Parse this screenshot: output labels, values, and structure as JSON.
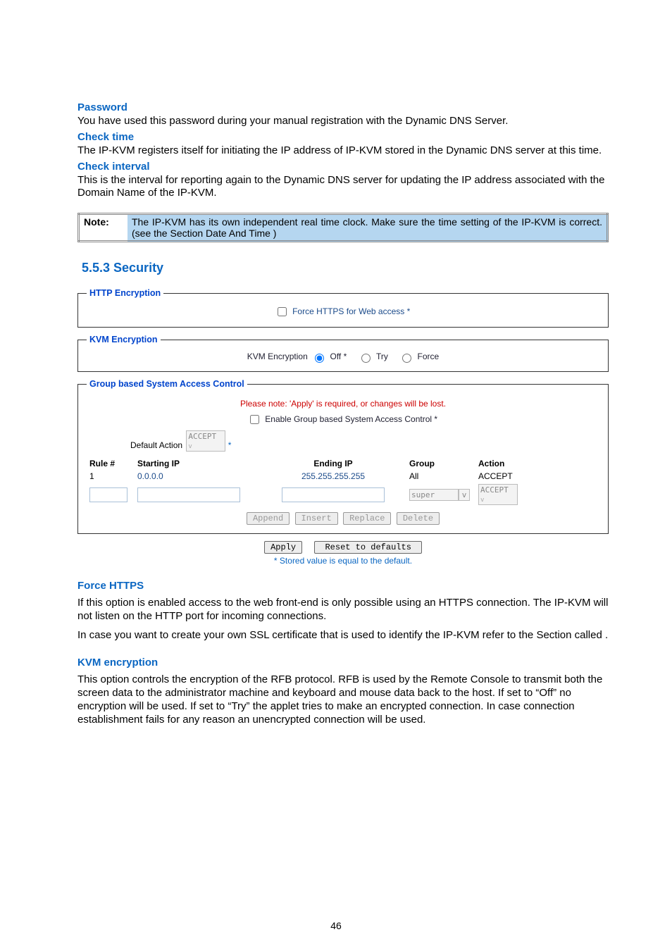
{
  "sections": {
    "password": {
      "heading": "Password",
      "body": "You have used this password during your manual registration with the Dynamic DNS Server."
    },
    "checkTime": {
      "heading": "Check time",
      "body": "The IP-KVM registers itself for initiating the IP address of IP-KVM stored in the Dynamic DNS server at this time."
    },
    "checkInterval": {
      "heading": "Check interval",
      "body": "This is the interval for reporting again to the Dynamic DNS server for updating the IP address associated with the Domain Name of the IP-KVM."
    }
  },
  "note": {
    "label": "Note:",
    "body": "The IP-KVM has its own independent real time clock. Make sure the time setting of the IP-KVM is correct. (see the Section Date And Time )"
  },
  "securityHeading": "5.5.3 Security",
  "httpEncryption": {
    "legend": "HTTP Encryption",
    "checkboxLabel": "Force HTTPS for Web access *"
  },
  "kvmEncryption": {
    "legend": "KVM Encryption",
    "label": "KVM Encryption",
    "options": {
      "off": "Off *",
      "try": "Try",
      "force": "Force"
    }
  },
  "groupControl": {
    "legend": "Group based System Access Control",
    "warning": "Please note: 'Apply' is required, or changes will be lost.",
    "enableLabel": "Enable Group based System Access Control *",
    "defaultActionLabel": "Default Action",
    "defaultActionValue": "ACCEPT",
    "asterisk": "*",
    "headers": {
      "rule": "Rule #",
      "start": "Starting IP",
      "end": "Ending IP",
      "group": "Group",
      "action": "Action"
    },
    "rows": [
      {
        "rule": "1",
        "start": "0.0.0.0",
        "end": "255.255.255.255",
        "group": "All",
        "action": "ACCEPT"
      }
    ],
    "inputRow": {
      "groupValue": "super",
      "actionValue": "ACCEPT"
    },
    "buttons": {
      "append": "Append",
      "insert": "Insert",
      "replace": "Replace",
      "delete": "Delete"
    }
  },
  "formButtons": {
    "apply": "Apply",
    "reset": "Reset to defaults"
  },
  "footnoteText": "* Stored value is equal to the default.",
  "forceHttps": {
    "heading": "Force HTTPS",
    "p1": "If this option is enabled access to the web front-end is only possible using an HTTPS connection. The IP-KVM will not listen on the HTTP port for incoming connections.",
    "p2": "In case you want to create your own SSL certificate that is used to identify the IP-KVM refer to the Section called                  ."
  },
  "kvmEnc": {
    "heading": "KVM encryption",
    "p": "This option controls the encryption of the RFB protocol. RFB is used by the Remote Console to transmit both the screen data to the administrator machine and keyboard and mouse data back to the host. If set to “Off” no encryption will be used. If set to “Try” the applet tries to make an encrypted connection. In case connection establishment fails for any reason an unencrypted connection will be used."
  },
  "pageNumber": "46"
}
